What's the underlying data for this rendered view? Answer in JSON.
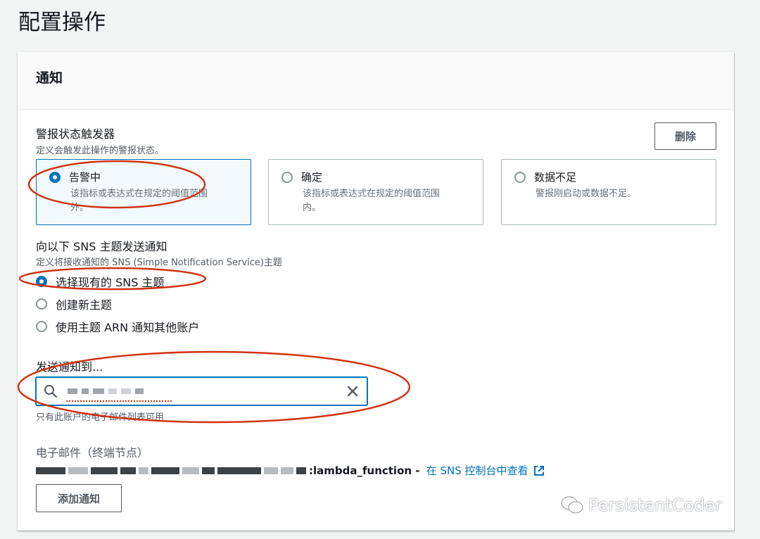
{
  "page_title": "配置操作",
  "panel": {
    "title": "通知",
    "trigger": {
      "label": "警报状态触发器",
      "description": "定义会触发此操作的警报状态。",
      "delete_label": "删除",
      "options": [
        {
          "label": "告警中",
          "desc_line1": "该指标或表达式在规定的阈值范围",
          "desc_line2": "外。",
          "selected": true
        },
        {
          "label": "确定",
          "desc_line1": "该指标或表达式在规定的阈值范围",
          "desc_line2": "内。",
          "selected": false
        },
        {
          "label": "数据不足",
          "desc_line1": "警报刚启动或数据不足。",
          "desc_line2": "",
          "selected": false
        }
      ]
    },
    "sns": {
      "label": "向以下 SNS 主题发送通知",
      "description": "定义将接收通知的 SNS (Simple Notification Service)主题",
      "options": [
        {
          "label": "选择现有的 SNS 主题",
          "selected": true
        },
        {
          "label": "创建新主题",
          "selected": false
        },
        {
          "label": "使用主题 ARN 通知其他账户",
          "selected": false
        }
      ]
    },
    "send_to": {
      "label": "发送通知到...",
      "hint": "只有此账户的电子邮件列表可用",
      "search_icon": "search-icon",
      "clear_icon": "close-icon"
    },
    "endpoint": {
      "label": "电子邮件（终端节点）",
      "arn_suffix": ":lambda_function",
      "separator": " - ",
      "view_link": "在 SNS 控制台中查看",
      "link_icon": "external-link-icon"
    },
    "add_notification_label": "添加通知"
  },
  "watermark": "PersistentCoder",
  "colors": {
    "accent": "#0073bb",
    "annotation": "#d13212"
  }
}
